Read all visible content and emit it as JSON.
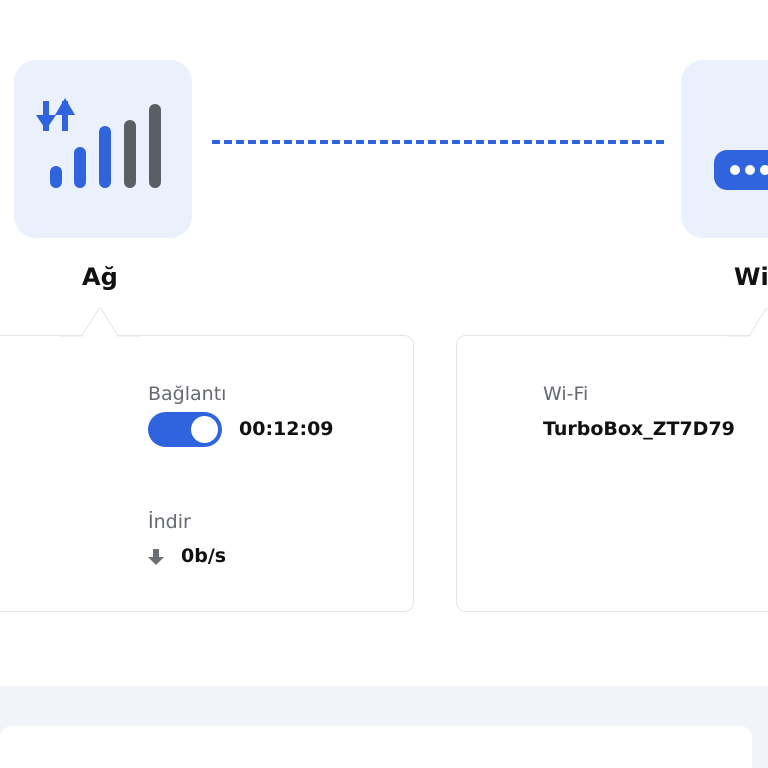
{
  "nodes": {
    "network": {
      "label": "Ağ",
      "icon": "signal-strength-icon"
    },
    "wifi": {
      "label": "Wi",
      "icon": "router-icon"
    }
  },
  "connection_status": {
    "label": "Bağlantı",
    "enabled": true,
    "duration": "00:12:09"
  },
  "download": {
    "label": "İndir",
    "icon": "download-arrow-icon",
    "rate": "0b/s"
  },
  "wifi_info": {
    "label": "Wi-Fi",
    "ssid": "TurboBox_ZT7D79"
  },
  "colors": {
    "accent": "#2f64de",
    "tile_background": "#eaf0fc",
    "signal_dim": "#5a5f66",
    "card_border": "#e2e5ea",
    "band_background": "#f1f4f9"
  }
}
